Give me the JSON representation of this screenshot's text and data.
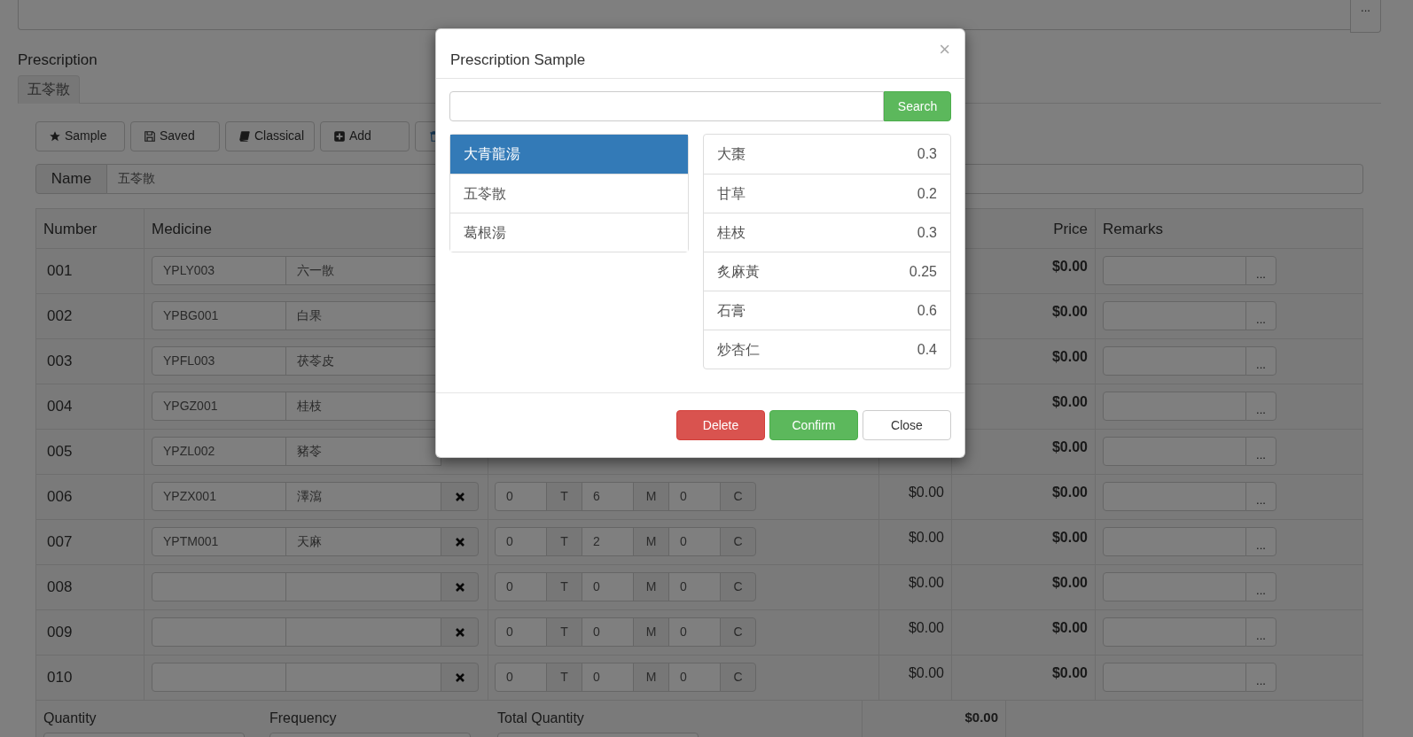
{
  "top_field": {
    "button": "..."
  },
  "prescription": {
    "title": "Prescription",
    "tabs": [
      {
        "label": "五苓散",
        "selected": true
      }
    ]
  },
  "toolbar": [
    {
      "kind": "sample",
      "label": "Sample"
    },
    {
      "kind": "saved",
      "label": "Saved"
    },
    {
      "kind": "classical",
      "label": "Classical"
    },
    {
      "kind": "add",
      "label": "Add"
    },
    {
      "kind": "delete"
    }
  ],
  "name_field": {
    "label": "Name",
    "value": "五苓散"
  },
  "table": {
    "columns": [
      "Number",
      "Medicine",
      "Price",
      "Remarks"
    ],
    "rows": [
      {
        "number": "001",
        "code": "YPLY003",
        "medicine": "六一散",
        "price": "$0.00",
        "remarks_button": "..."
      },
      {
        "number": "002",
        "code": "YPBG001",
        "medicine": "白果",
        "price": "$0.00",
        "remarks_button": "..."
      },
      {
        "number": "003",
        "code": "YPFL003",
        "medicine": "茯苓皮",
        "price": "$0.00",
        "remarks_button": "..."
      },
      {
        "number": "004",
        "code": "YPGZ001",
        "medicine": "桂枝",
        "price": "$0.00",
        "remarks_button": "..."
      },
      {
        "number": "005",
        "code": "YPZL002",
        "medicine": "豬苓",
        "price": "$0.00",
        "remarks_button": "..."
      },
      {
        "number": "006",
        "code": "YPZX001",
        "medicine": "澤瀉",
        "dose": [
          {
            "value": "0",
            "unit": "T"
          },
          {
            "value": "6",
            "unit": "M"
          },
          {
            "value": "0",
            "unit": "C"
          }
        ],
        "column_4": "$0.00",
        "price": "$0.00",
        "remarks_button": "..."
      },
      {
        "number": "007",
        "code": "YPTM001",
        "medicine": "天麻",
        "dose": [
          {
            "value": "0",
            "unit": "T"
          },
          {
            "value": "2",
            "unit": "M"
          },
          {
            "value": "0",
            "unit": "C"
          }
        ],
        "column_4": "$0.00",
        "price": "$0.00",
        "remarks_button": "..."
      },
      {
        "number": "008",
        "dose": [
          {
            "value": "0",
            "unit": "T"
          },
          {
            "value": "0",
            "unit": "M"
          },
          {
            "value": "0",
            "unit": "C"
          }
        ],
        "column_4": "$0.00",
        "price": "$0.00",
        "remarks_button": "..."
      },
      {
        "number": "009",
        "dose": [
          {
            "value": "0",
            "unit": "T"
          },
          {
            "value": "0",
            "unit": "M"
          },
          {
            "value": "0",
            "unit": "C"
          }
        ],
        "column_4": "$0.00",
        "price": "$0.00",
        "remarks_button": "..."
      },
      {
        "number": "010",
        "dose": [
          {
            "value": "0",
            "unit": "T"
          },
          {
            "value": "0",
            "unit": "M"
          },
          {
            "value": "0",
            "unit": "C"
          }
        ],
        "column_4": "$0.00",
        "price": "$0.00",
        "remarks_button": "..."
      }
    ],
    "footer": {
      "fields": [
        "Quantity",
        "Frequency",
        "Total Quantity"
      ],
      "price": "$0.00"
    }
  },
  "dialog": {
    "title": "Prescription Sample",
    "close": "×",
    "search_button": "Search",
    "samples": [
      {
        "label": "大青龍湯",
        "selected": true
      },
      {
        "label": "五苓散",
        "selected": false
      },
      {
        "label": "葛根湯",
        "selected": false
      }
    ],
    "ingredients": [
      {
        "name": "大棗",
        "amount": "0.3"
      },
      {
        "name": "甘草",
        "amount": "0.2"
      },
      {
        "name": "桂枝",
        "amount": "0.3"
      },
      {
        "name": "炙麻黃",
        "amount": "0.25"
      },
      {
        "name": "石膏",
        "amount": "0.6"
      },
      {
        "name": "炒杏仁",
        "amount": "0.4"
      }
    ],
    "buttons": [
      {
        "kind": "danger",
        "label": "Delete"
      },
      {
        "kind": "success",
        "label": "Confirm"
      },
      {
        "kind": "default",
        "label": "Close"
      }
    ]
  }
}
